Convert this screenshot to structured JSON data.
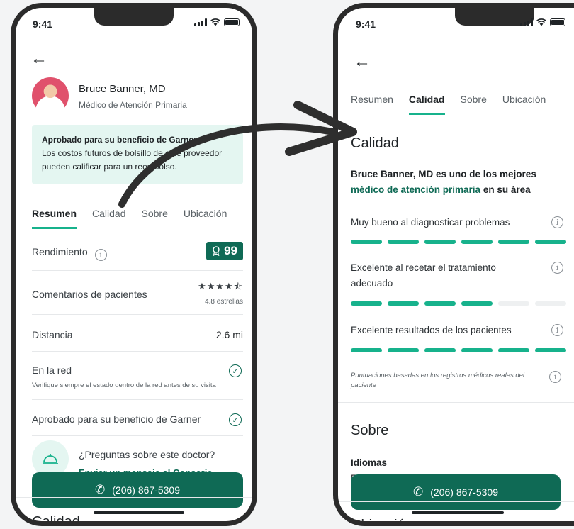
{
  "status": {
    "time": "9:41"
  },
  "left": {
    "doctor": {
      "name": "Bruce Banner, MD",
      "role": "Médico de Atención Primaria"
    },
    "banner": {
      "title": "Aprobado para su beneficio de Garner...",
      "body": "Los costos futuros de bolsillo de este proveedor pueden calificar para un reembolso."
    },
    "tabs": [
      "Resumen",
      "Calidad",
      "Sobre",
      "Ubicación"
    ],
    "performance": {
      "label": "Rendimiento",
      "score": "99"
    },
    "reviews": {
      "label": "Comentarios de pacientes",
      "stars": "★★★★⯪",
      "rating": "4.8 estrellas"
    },
    "distance": {
      "label": "Distancia",
      "value": "2.6 mi"
    },
    "network": {
      "label": "En la red",
      "note": "Verifique siempre el estado dentro de la red antes de su visita"
    },
    "approved": {
      "label": "Aprobado para su beneficio de Garner"
    },
    "questions": {
      "title": "¿Preguntas sobre este doctor?",
      "link": "Enviar un mensaje al Conserje"
    },
    "call_label": "(206) 867-5309",
    "next_section": "Calidad"
  },
  "right": {
    "tabs": [
      "Resumen",
      "Calidad",
      "Sobre",
      "Ubicación"
    ],
    "heading": "Calidad",
    "intro_prefix": "Bruce Banner, MD es uno de los mejores",
    "intro_accent": "médico de atención primaria",
    "intro_suffix": "en su área",
    "criteria": [
      {
        "label": "Muy bueno al diagnosticar problemas",
        "filled": 6,
        "total": 6
      },
      {
        "label": "Excelente al recetar el tratamiento adecuado",
        "filled": 4,
        "total": 6
      },
      {
        "label": "Excelente resultados de los pacientes",
        "filled": 6,
        "total": 6
      }
    ],
    "note": "Puntuaciones basadas en los registros médicos reales del paciente",
    "about_heading": "Sobre",
    "languages_label": "Idiomas",
    "languages_value": "E",
    "call_label": "(206) 867-5309",
    "next_section": "Ubicación"
  },
  "colors": {
    "primary": "#0f6a55",
    "accent": "#17b28c",
    "banner": "#e4f6f1"
  }
}
